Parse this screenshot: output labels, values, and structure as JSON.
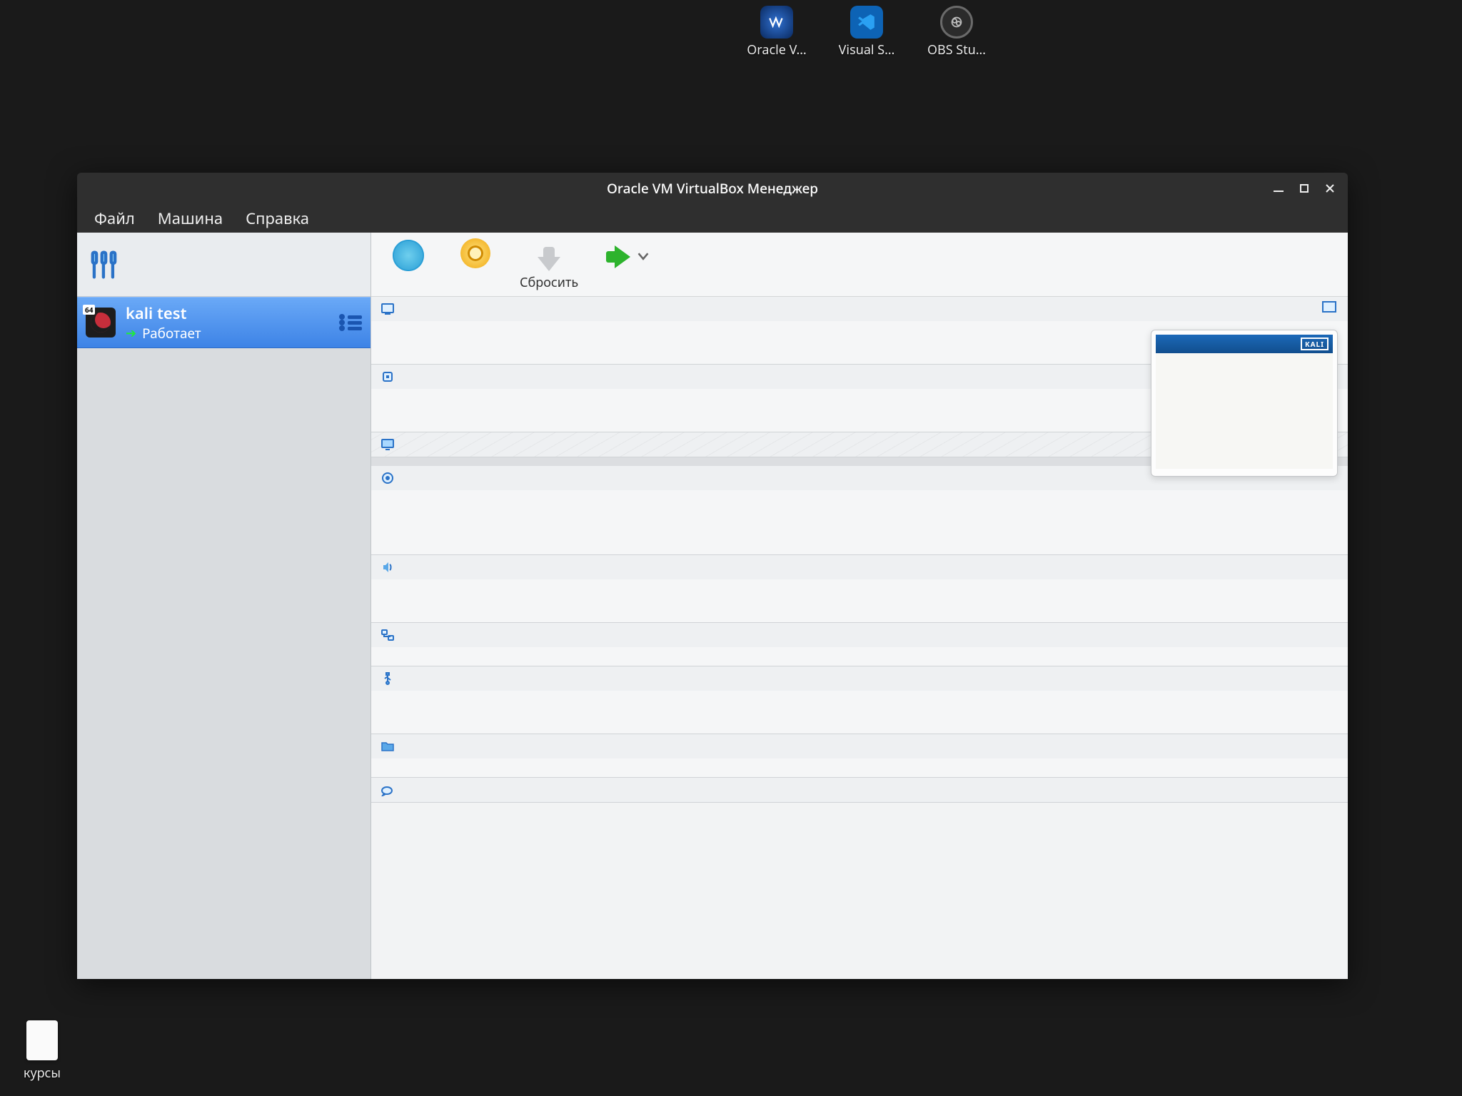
{
  "desktop": {
    "top_icons": [
      {
        "label": "Oracle V…",
        "key": "oracle"
      },
      {
        "label": "Visual S…",
        "key": "vscode"
      },
      {
        "label": "OBS Stu…",
        "key": "obs"
      }
    ],
    "bottom_icon": {
      "label": "курсы"
    }
  },
  "window": {
    "title": "Oracle VM VirtualBox Менеджер",
    "menu": {
      "file": "Файл",
      "machine": "Машина",
      "help": "Справка"
    },
    "toolbar": {
      "new": "",
      "settings": "",
      "discard": "Сбросить",
      "start": ""
    },
    "vm": {
      "name": "kali test",
      "status": "Работает"
    },
    "preview": {
      "badge": "KALI",
      "line1": ""
    },
    "sections": [
      {
        "icon": "general",
        "label": ""
      },
      {
        "icon": "system",
        "label": ""
      },
      {
        "icon": "display",
        "label": ""
      },
      {
        "icon": "storage",
        "label": ""
      },
      {
        "icon": "audio",
        "label": ""
      },
      {
        "icon": "network",
        "label": ""
      },
      {
        "icon": "usb",
        "label": ""
      },
      {
        "icon": "shared",
        "label": ""
      },
      {
        "icon": "desc",
        "label": ""
      }
    ]
  }
}
